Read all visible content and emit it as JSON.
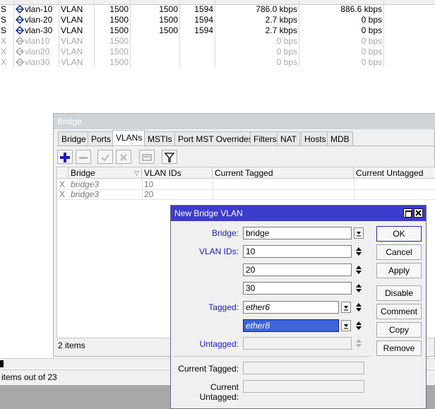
{
  "interfaces": {
    "rows": [
      {
        "flag": "S",
        "name": "vlan-10",
        "type": "VLAN",
        "mtu": "1500",
        "actual_mtu": "1500",
        "l2mtu": "1594",
        "tx": "786.0 kbps",
        "rx": "886.6 kbps",
        "disabled": false
      },
      {
        "flag": "S",
        "name": "vlan-20",
        "type": "VLAN",
        "mtu": "1500",
        "actual_mtu": "1500",
        "l2mtu": "1594",
        "tx": "2.7 kbps",
        "rx": "0 bps",
        "disabled": false
      },
      {
        "flag": "S",
        "name": "vlan-30",
        "type": "VLAN",
        "mtu": "1500",
        "actual_mtu": "1500",
        "l2mtu": "1594",
        "tx": "2.7 kbps",
        "rx": "0 bps",
        "disabled": false
      },
      {
        "flag": "X",
        "name": "vlan10",
        "type": "VLAN",
        "mtu": "1500",
        "actual_mtu": "",
        "l2mtu": "",
        "tx": "0 bps",
        "rx": "0 bps",
        "disabled": true
      },
      {
        "flag": "X",
        "name": "vlan20",
        "type": "VLAN",
        "mtu": "1500",
        "actual_mtu": "",
        "l2mtu": "",
        "tx": "0 bps",
        "rx": "0 bps",
        "disabled": true
      },
      {
        "flag": "X",
        "name": "vlan30",
        "type": "VLAN",
        "mtu": "1500",
        "actual_mtu": "",
        "l2mtu": "",
        "tx": "0 bps",
        "rx": "0 bps",
        "disabled": true
      }
    ],
    "status": "items out of 23"
  },
  "bridge_window": {
    "title": "Bridge",
    "tabs": [
      "Bridge",
      "Ports",
      "VLANs",
      "MSTIs",
      "Port MST Overrides",
      "Filters",
      "NAT",
      "Hosts",
      "MDB"
    ],
    "active_tab": "VLANs",
    "columns": [
      "Bridge",
      "VLAN IDs",
      "Current Tagged",
      "Current Untagged"
    ],
    "rows": [
      {
        "flag": "X",
        "bridge": "bridge3",
        "vlan_ids": "10"
      },
      {
        "flag": "X",
        "bridge": "bridge3",
        "vlan_ids": "20"
      }
    ],
    "items_count": "2 items"
  },
  "dialog": {
    "title": "New Bridge VLAN",
    "bridge_label": "Bridge:",
    "bridge_value": "bridge",
    "vlan_ids_label": "VLAN IDs:",
    "vlan_ids": [
      "10",
      "20",
      "30"
    ],
    "tagged_label": "Tagged:",
    "tagged": [
      "ether6",
      "ether8"
    ],
    "untagged_label": "Untagged:",
    "untagged_value": "",
    "current_tagged_label": "Current Tagged:",
    "current_untagged_label": "Current Untagged:",
    "buttons": {
      "ok": "OK",
      "cancel": "Cancel",
      "apply": "Apply",
      "disable": "Disable",
      "comment": "Comment",
      "copy": "Copy",
      "remove": "Remove"
    }
  },
  "colors": {
    "dialog_title_bar": "#3c3ccd",
    "field_label_blue": "#1a1acd",
    "selection": "#3c66d9"
  }
}
